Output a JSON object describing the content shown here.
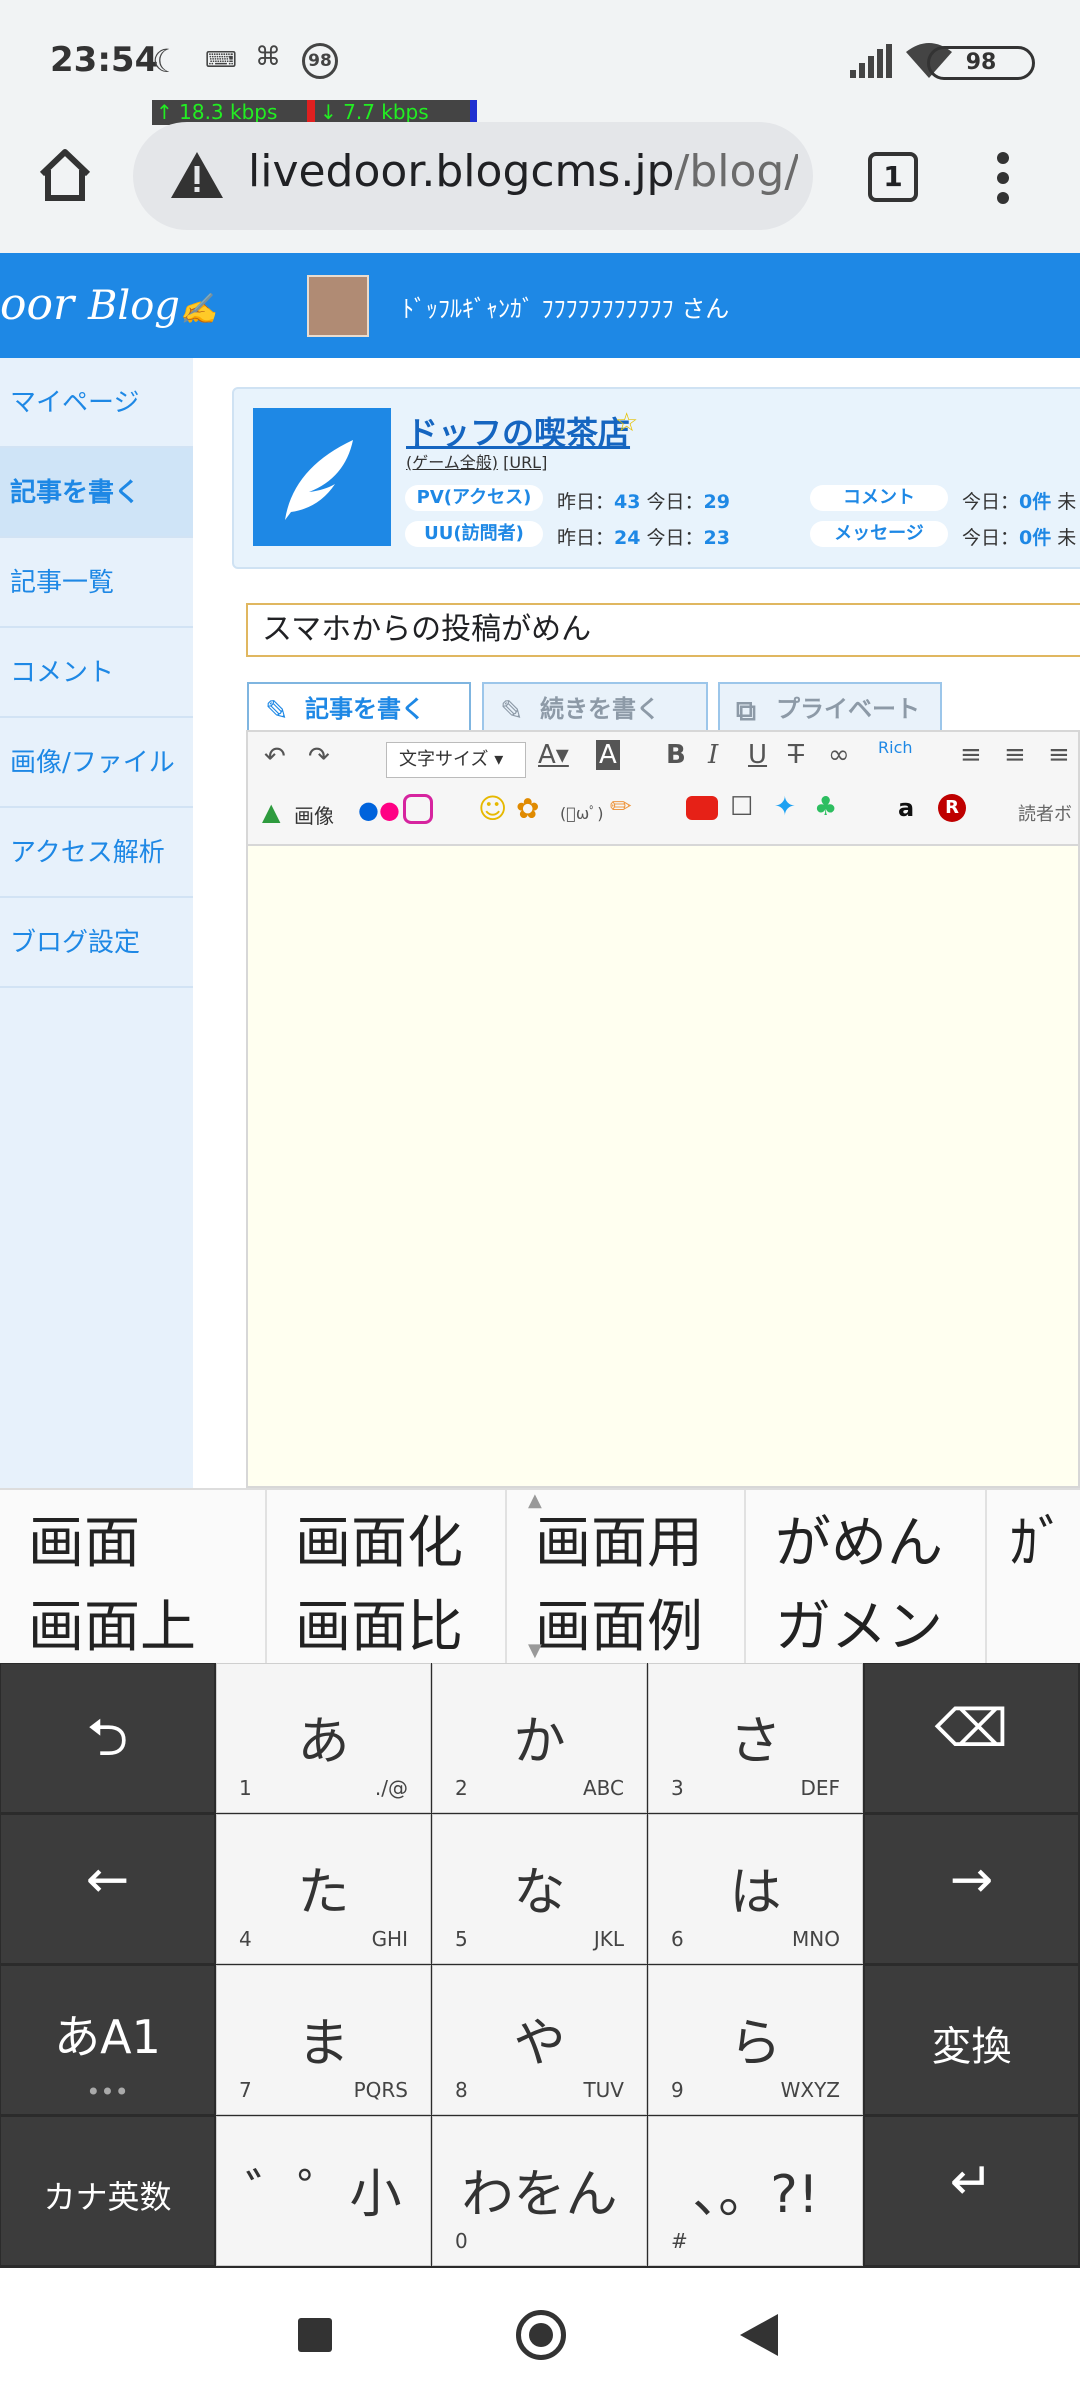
{
  "status_bar": {
    "time": "23:54",
    "upload_speed": "↑   18.3 kbps",
    "download_speed": "↓   7.7 kbps",
    "notif_badge": "98",
    "battery": "98",
    "icons": [
      "moon-icon",
      "keyboard-icon",
      "ghost-icon",
      "badge-icon",
      "signal-icon",
      "wifi-icon",
      "battery-icon"
    ]
  },
  "browser": {
    "url_host": "livedoor.blogcms.jp",
    "url_path": "/blog/dc",
    "tab_count": "1"
  },
  "blog_header": {
    "logo_left": "oor",
    "logo_right": "Blog",
    "username": "ﾄﾞｯﾌﾙｷﾞｬﾝｶﾞ ﾌﾌﾌﾌﾌﾌﾌﾌﾌﾌﾌ さん"
  },
  "sidebar": {
    "items": [
      {
        "label": "マイページ"
      },
      {
        "label": "記事を書く"
      },
      {
        "label": "記事一覧"
      },
      {
        "label": "コメント"
      },
      {
        "label": "画像/ファイル"
      },
      {
        "label": "アクセス解析"
      },
      {
        "label": "ブログ設定"
      }
    ]
  },
  "blog_info": {
    "name": "ドッフの喫茶店",
    "category": "(ゲーム全般)",
    "url_link": "[URL]",
    "pv_label": "PV(アクセス)",
    "uu_label": "UU(訪問者)",
    "yesterday_label": "昨日：",
    "today_label": "今日：",
    "pv_yesterday": "43",
    "pv_today": "29",
    "uu_yesterday": "24",
    "uu_today": "23",
    "comment_label": "コメント",
    "message_label": "メッセージ",
    "comment_today": "0件",
    "message_today": "0件",
    "trailing": "未"
  },
  "editor": {
    "title_value": "スマホからの投稿がめん",
    "tab_write": "記事を書く",
    "tab_continue": "続きを書く",
    "tab_private": "プライベート",
    "font_size": "文字サイズ",
    "image_label": "画像",
    "reader_label": "読者ボ",
    "rich_label": "Rich"
  },
  "candidates": [
    {
      "top": "画面",
      "bottom": "画面上"
    },
    {
      "top": "画面化",
      "bottom": "画面比"
    },
    {
      "top": "画面用",
      "bottom": "画面例"
    },
    {
      "top": "がめん",
      "bottom": "ガメン"
    },
    {
      "top": "ｶﾞ",
      "bottom": ""
    }
  ],
  "keyboard": {
    "a": "あ",
    "a_num": "1",
    "a_sub": "./@",
    "ka": "か",
    "ka_num": "2",
    "ka_sub": "ABC",
    "sa": "さ",
    "sa_num": "3",
    "sa_sub": "DEF",
    "ta": "た",
    "ta_num": "4",
    "ta_sub": "GHI",
    "na": "な",
    "na_num": "5",
    "na_sub": "JKL",
    "ha": "は",
    "ha_num": "6",
    "ha_sub": "MNO",
    "ma": "ま",
    "ma_num": "7",
    "ma_sub": "PQRS",
    "ya": "や",
    "ya_num": "8",
    "ya_sub": "TUV",
    "ra": "ら",
    "ra_num": "9",
    "ra_sub": "WXYZ",
    "dakuten": "゛゜小",
    "wa": "わをん",
    "wa_num": "0",
    "punct": "、。?!",
    "punct_num": "#",
    "mode": "あA1",
    "kana_eisu": "カナ英数",
    "convert": "変換"
  }
}
